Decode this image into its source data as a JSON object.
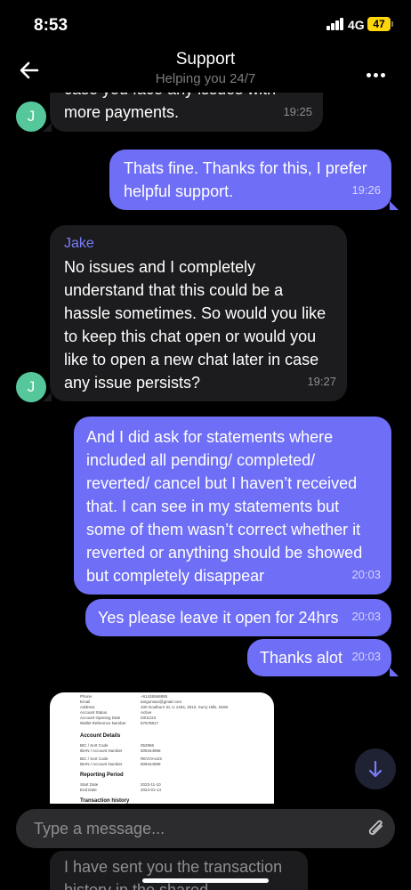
{
  "status_bar": {
    "time": "8:53",
    "network": "4G",
    "battery": "47"
  },
  "header": {
    "title": "Support",
    "subtitle": "Helping you 24/7"
  },
  "messages": [
    {
      "sender": "agent",
      "avatar": "J",
      "text": "case you face any issues with more payments.",
      "time": "19:25"
    },
    {
      "sender": "user",
      "text": "Thats fine. Thanks for this, I prefer helpful support.",
      "time": "19:26"
    },
    {
      "sender": "agent",
      "name": "Jake",
      "avatar": "J",
      "text": "No issues and I completely understand that this could be a hassle sometimes. So would you like to keep this chat open or would you like to open a new chat later in case any issue persists?",
      "time": "19:27"
    },
    {
      "sender": "user",
      "text": "And I did ask for statements where included all pending/ completed/ reverted/ cancel but I haven’t received that. I can see in my statements but some of them wasn’t correct whether it reverted or anything should be showed but completely disappear",
      "time": "20:03"
    },
    {
      "sender": "user",
      "text": "Yes please leave it open for 24hrs",
      "time": "20:03"
    },
    {
      "sender": "user",
      "text": "Thanks alot",
      "time": "20:03"
    }
  ],
  "document_preview": {
    "rows": [
      {
        "label": "Phone",
        "value": "+61426568885"
      },
      {
        "label": "Email",
        "value": "tangonsao@gmail.com"
      },
      {
        "label": "Address",
        "value": "100 Goulburn St, U 1404, 2010, Surry Hills, NSW"
      },
      {
        "label": "Account Status",
        "value": "Active"
      },
      {
        "label": "Account Opening Date",
        "value": "03/11/23"
      },
      {
        "label": "Wallet Reference Number",
        "value": "87678817"
      }
    ],
    "section_account": "Account Details",
    "acct_rows": [
      {
        "label": "BIC / Sort Code",
        "value": "052966"
      },
      {
        "label": "IBAN / Account Number",
        "value": "509444958"
      },
      {
        "label": "BIC / Sort Code",
        "value": "REVOAU22"
      },
      {
        "label": "IBAN / Account Number",
        "value": "509444958"
      }
    ],
    "section_period": "Reporting Period",
    "period_rows": [
      {
        "label": "Start Date",
        "value": "2023-11-10"
      },
      {
        "label": "End Date",
        "value": "2024-01-14"
      }
    ],
    "section_history": "Transaction history"
  },
  "input": {
    "placeholder": "Type a message..."
  },
  "below_input_message": "I have sent you the transaction history in the shared"
}
